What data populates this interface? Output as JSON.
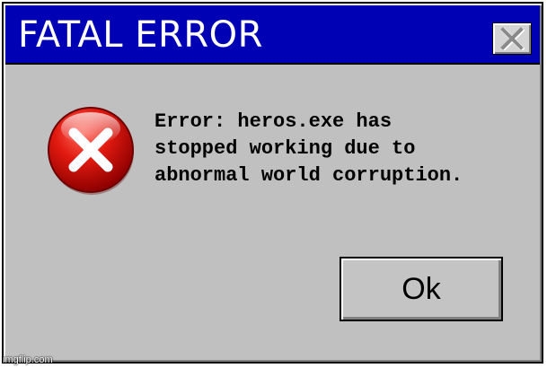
{
  "window": {
    "title": "FATAL ERROR",
    "close_icon": "close-x-icon",
    "title_bar_color": "#0000b4",
    "body_color": "#c0c0c0"
  },
  "content": {
    "icon": "error-icon",
    "icon_color": "#dd0000",
    "message": "Error: heros.exe has\nstopped working due to\nabnormal world corruption."
  },
  "buttons": {
    "ok_label": "Ok"
  },
  "watermark": {
    "text": "imgflip.com"
  }
}
